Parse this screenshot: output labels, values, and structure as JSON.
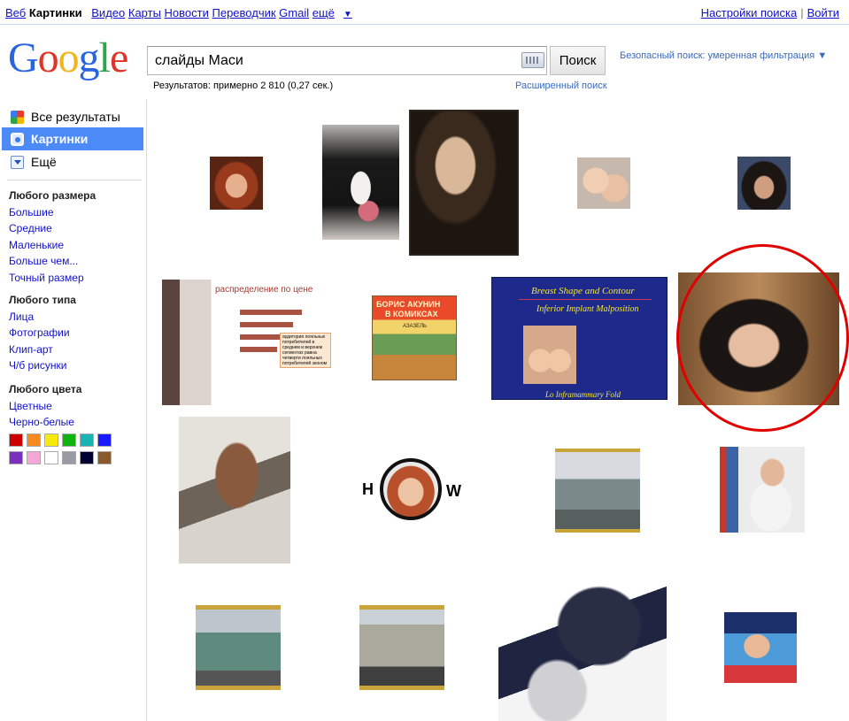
{
  "topnav": {
    "items": [
      "Веб",
      "Картинки",
      "Видео",
      "Карты",
      "Новости",
      "Переводчик",
      "Gmail",
      "ещё"
    ],
    "current_index": 1,
    "more_arrow": "▼",
    "settings": "Настройки поиска",
    "separator": "|",
    "login": "Войти"
  },
  "logo": {
    "letters": [
      "G",
      "o",
      "o",
      "g",
      "l",
      "e"
    ]
  },
  "search": {
    "query": "слайды Маси",
    "button": "Поиск",
    "safe_search": "Безопасный поиск: умеренная фильтрация ▼",
    "results_count": "Результатов: примерно 2 810 (0,27 сек.)",
    "advanced": "Расширенный поиск"
  },
  "sidebar": {
    "modes": [
      "Все результаты",
      "Картинки",
      "Ещё"
    ],
    "selected_mode": 1,
    "size": {
      "header": "Любого размера",
      "items": [
        "Большие",
        "Средние",
        "Маленькие",
        "Больше чем...",
        "Точный размер"
      ]
    },
    "type": {
      "header": "Любого типа",
      "items": [
        "Лица",
        "Фотографии",
        "Клип-арт",
        "Ч/б рисунки"
      ]
    },
    "color": {
      "header": "Любого цвета",
      "items": [
        "Цветные",
        "Черно-белые"
      ]
    },
    "swatch_colors": [
      "#cc0000",
      "#f6891f",
      "#f6ea0a",
      "#11b311",
      "#19b3b3",
      "#1a1aff",
      "#7a2fbd",
      "#f7a6d8",
      "#ffffff",
      "#9a9aa4",
      "#000033",
      "#8b5a2b"
    ]
  },
  "images": {
    "chart_slide": {
      "title": "распределение по цене",
      "note": "аудитория лояльных потребителей в среднем и верхнем сегментах равна четверти лояльных потребителей эконом"
    },
    "comic": {
      "line1": "БОРИС АКУНИН",
      "line2": "В КОМИКСАХ",
      "line3": "АЗАЗЕЛЬ"
    },
    "medical": {
      "title": "Breast Shape and Contour",
      "subtitle": "Inferior Implant Malposition",
      "footer": "Lo   Inframammary Fold"
    },
    "how": {
      "h": "H",
      "w": "W"
    }
  },
  "highlight": {
    "color": "#e00000"
  }
}
